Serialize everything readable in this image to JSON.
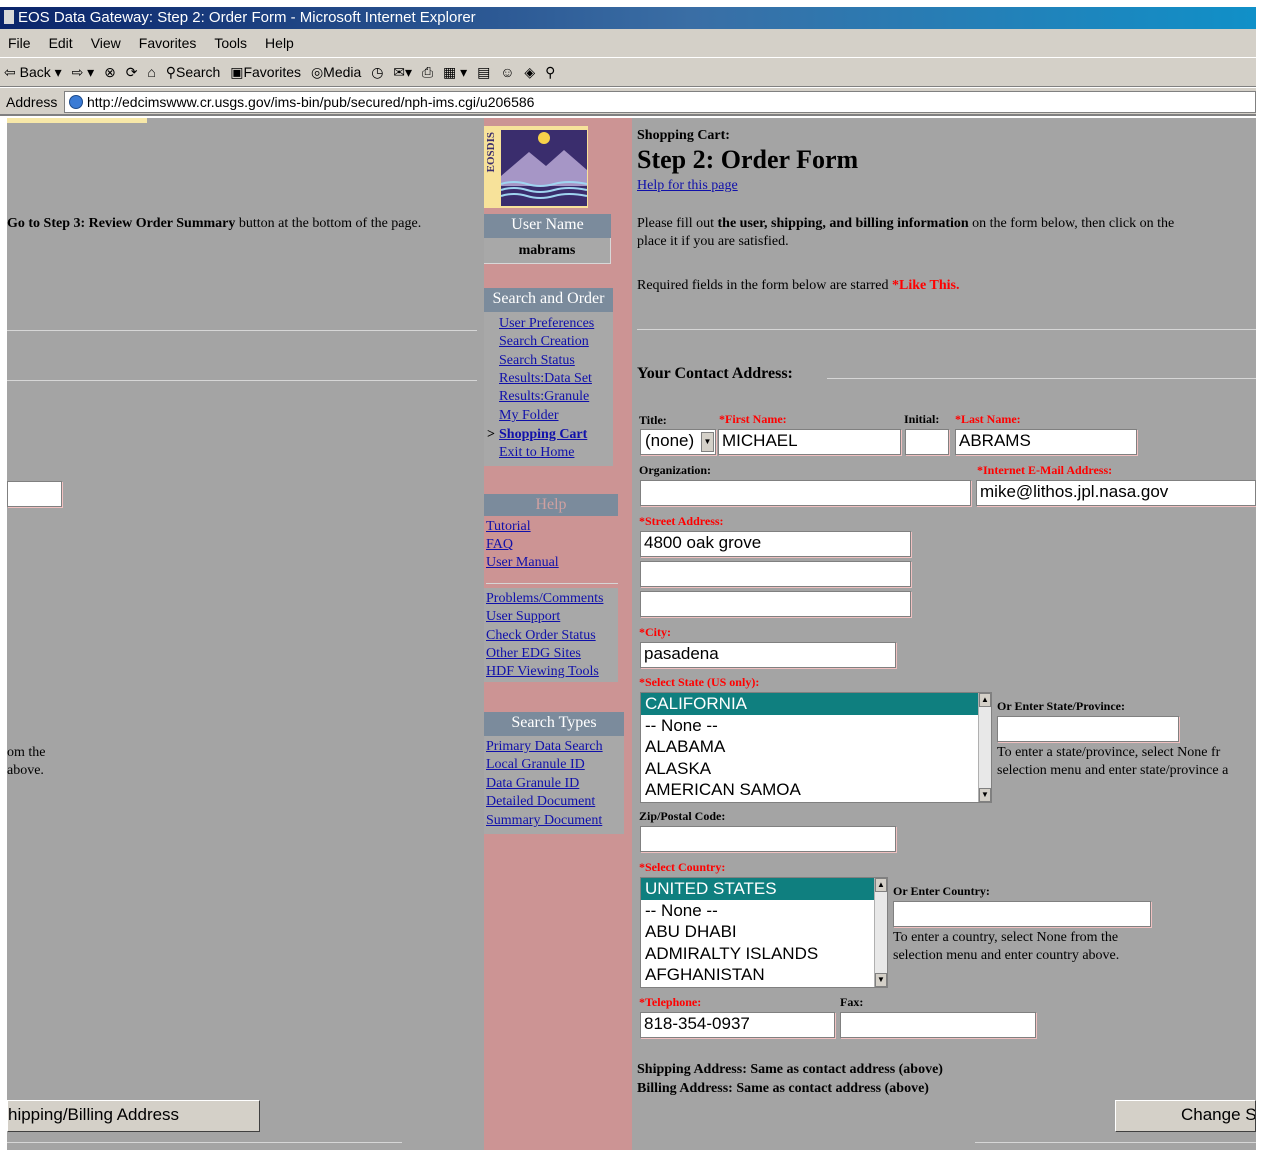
{
  "window": {
    "title": "EOS Data Gateway: Step 2: Order Form - Microsoft Internet Explorer"
  },
  "menu": [
    "File",
    "Edit",
    "View",
    "Favorites",
    "Tools",
    "Help"
  ],
  "toolbar": {
    "back": "⇦ Back ▾",
    "forward": "⇨ ▾",
    "stop": "⊗",
    "refresh": "⟳",
    "home": "⌂",
    "search": "Search",
    "favorites": "Favorites",
    "media": "Media",
    "history": "◷",
    "mail": "✉▾",
    "print": "⎙",
    "edit": "▦ ▾",
    "discuss": "▤",
    "messenger": "☺",
    "extra1": "◈",
    "extra2": "⚲"
  },
  "address": {
    "label": "Address",
    "url": "http://edcimswww.cr.usgs.gov/ims-bin/pub/secured/nph-ims.cgi/u206586"
  },
  "left": {
    "step3_prefix": "Go to Step 3: Review Order Summary",
    "step3_suffix": " button at the bottom of the page.",
    "fragment1": "om the",
    "fragment2": "above.",
    "shipping_button": "hipping/Billing Address"
  },
  "sidebar": {
    "logo_text": "EOSDIS",
    "user_header": "User Name",
    "user_name": "mabrams",
    "search_order_header": "Search and Order",
    "search_links": [
      "User Preferences",
      "Search Creation",
      "Search Status",
      "Results:Data Set",
      "Results:Granule",
      "My Folder",
      "Shopping Cart",
      "Exit to Home"
    ],
    "current_marker": ">",
    "help_header": "Help",
    "help_links": [
      "Tutorial",
      "FAQ",
      "User Manual"
    ],
    "support_links": [
      "Problems/Comments",
      "User Support",
      "Check Order Status",
      "Other EDG Sites",
      "HDF Viewing Tools"
    ],
    "search_types_header": "Search Types",
    "search_types_links": [
      "Primary Data Search",
      "Local Granule ID",
      "Data Granule ID",
      "Detailed Document",
      "Summary Document"
    ]
  },
  "main": {
    "cart_label": "Shopping Cart:",
    "title": "Step 2: Order Form",
    "help_link": "Help for this page",
    "intro_prefix": "Please fill out ",
    "intro_bold": "the user, shipping, and billing information",
    "intro_suffix": " on the form below, then click on the",
    "intro_line2": "place it if you are satisfied.",
    "required_note": "Required fields in the form below are starred ",
    "required_example": "*Like This.",
    "section_title": "Your Contact Address:",
    "change_button": "Change S"
  },
  "form": {
    "title_label": "Title:",
    "title_value": "(none)",
    "first_name_label": "*First Name:",
    "first_name": "MICHAEL",
    "initial_label": "Initial:",
    "initial": "",
    "last_name_label": "*Last Name:",
    "last_name": "ABRAMS",
    "organization_label": "Organization:",
    "organization": "",
    "email_label": "*Internet E-Mail Address:",
    "email": "mike@lithos.jpl.nasa.gov",
    "street_label": "*Street Address:",
    "street1": "4800 oak grove",
    "street2": "",
    "street3": "",
    "city_label": "*City:",
    "city": "pasadena",
    "state_label": "*Select State (US only):",
    "state_options": [
      "CALIFORNIA",
      "-- None --",
      "ALABAMA",
      "ALASKA",
      "AMERICAN SAMOA"
    ],
    "state_other_label": "Or Enter State/Province:",
    "state_other": "",
    "state_note1": "To enter a state/province, select None fr",
    "state_note2": "selection menu and enter state/province a",
    "zip_label": "Zip/Postal Code:",
    "zip": "",
    "country_label": "*Select Country:",
    "country_options": [
      "UNITED STATES",
      "-- None --",
      "ABU DHABI",
      "ADMIRALTY ISLANDS",
      "AFGHANISTAN"
    ],
    "country_other_label": "Or Enter Country:",
    "country_other": "",
    "country_note1": "To enter a country, select None from the",
    "country_note2": "selection menu and enter country above.",
    "telephone_label": "*Telephone:",
    "telephone": "818-354-0937",
    "fax_label": "Fax:",
    "fax": "",
    "shipping_note": "Shipping Address: Same as contact address (above)",
    "billing_note": "Billing Address: Same as contact address (above)"
  },
  "colors": {
    "page_bg": "#a4a4a4",
    "sidebar_pink": "#cc9494",
    "nav_header": "#7b8b9c",
    "required_red": "#ff0000",
    "selected_teal": "#0f7f7f"
  }
}
